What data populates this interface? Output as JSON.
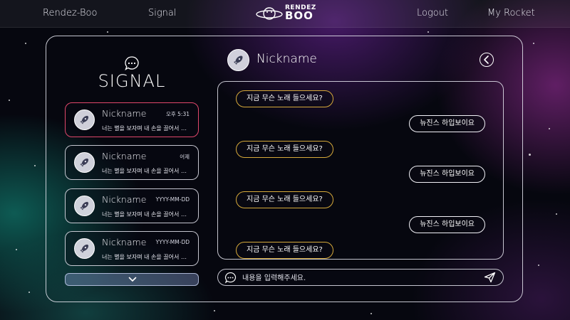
{
  "nav": {
    "brand": "Rendez-Boo",
    "signal": "Signal",
    "logout": "Logout",
    "rocket": "My Rocket",
    "logo_line1": "RENDEZ",
    "logo_line2": "BOO"
  },
  "sidebar": {
    "title": "SIGNAL",
    "conversations": [
      {
        "name": "Nickname",
        "time": "오후 5:31",
        "preview": "너는 별을 보자며 내 손을 끌어서 단 ...",
        "active": true
      },
      {
        "name": "Nickname",
        "time": "어제",
        "preview": "너는 별을 보자며 내 손을 끌어서 단 ...",
        "active": false
      },
      {
        "name": "Nickname",
        "time": "YYYY-MM-DD",
        "preview": "너는 별을 보자며 내 손을 끌어서 단 ...",
        "active": false
      },
      {
        "name": "Nickname",
        "time": "YYYY-MM-DD",
        "preview": "너는 별을 보자며 내 손을 끌어서 단 ...",
        "active": false
      }
    ]
  },
  "chat": {
    "partner_name": "Nickname",
    "messages": [
      {
        "direction": "in",
        "text": "지금 무슨 노래 들으세요?"
      },
      {
        "direction": "out",
        "text": "뉴진스 하입보이요"
      },
      {
        "direction": "in",
        "text": "지금 무슨 노래 들으세요?"
      },
      {
        "direction": "out",
        "text": "뉴진스 하입보이요"
      },
      {
        "direction": "in",
        "text": "지금 무슨 노래 들으세요?"
      },
      {
        "direction": "out",
        "text": "뉴진스 하입보이요"
      },
      {
        "direction": "in",
        "text": "지금 무슨 노래 들으세요?"
      }
    ],
    "input_placeholder": "내용을 입력해주세요."
  },
  "colors": {
    "active_border": "#e0476b",
    "incoming_bubble_border": "#d6a93a",
    "outgoing_bubble_border": "#f2f2f7",
    "more_button_fill": "#96aae6"
  },
  "icons": {
    "signal": "chat-bubble-icon",
    "avatar": "rocket-icon",
    "back": "back-arrow-icon",
    "more": "chevron-down-icon",
    "send": "send-icon"
  }
}
